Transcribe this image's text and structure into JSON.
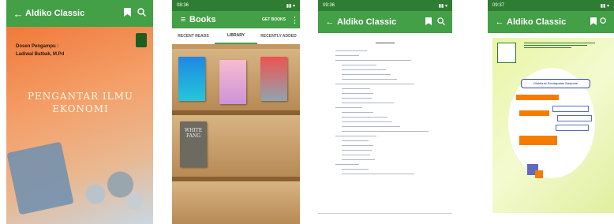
{
  "screen1": {
    "title": "Aldiko Classic",
    "author_line1": "Dosen Pengampu :",
    "author_line2": "Ladiwal Batbak, M.Pd",
    "book_title_line1": "PENGANTAR ILMU",
    "book_title_line2": "EKONOMI"
  },
  "screen2": {
    "status_time": "08:36",
    "title": "Books",
    "get_books": "GET BOOKS",
    "tabs": [
      "RECENT READS",
      "LIBRARY",
      "RECENTLY ADDED"
    ],
    "active_tab": "LIBRARY",
    "white_fang_title": "WHITE FANG"
  },
  "screen3": {
    "status_time": "09:36",
    "title": "Aldiko Classic"
  },
  "screen4": {
    "status_time": "09:37",
    "title": "Aldiko Classic",
    "diagram_title": "Distribusi Pendapatan Nasional"
  },
  "colors": {
    "appbar": "#43a047",
    "statusbar": "#2e7d32",
    "accent_orange": "#f57c00"
  }
}
